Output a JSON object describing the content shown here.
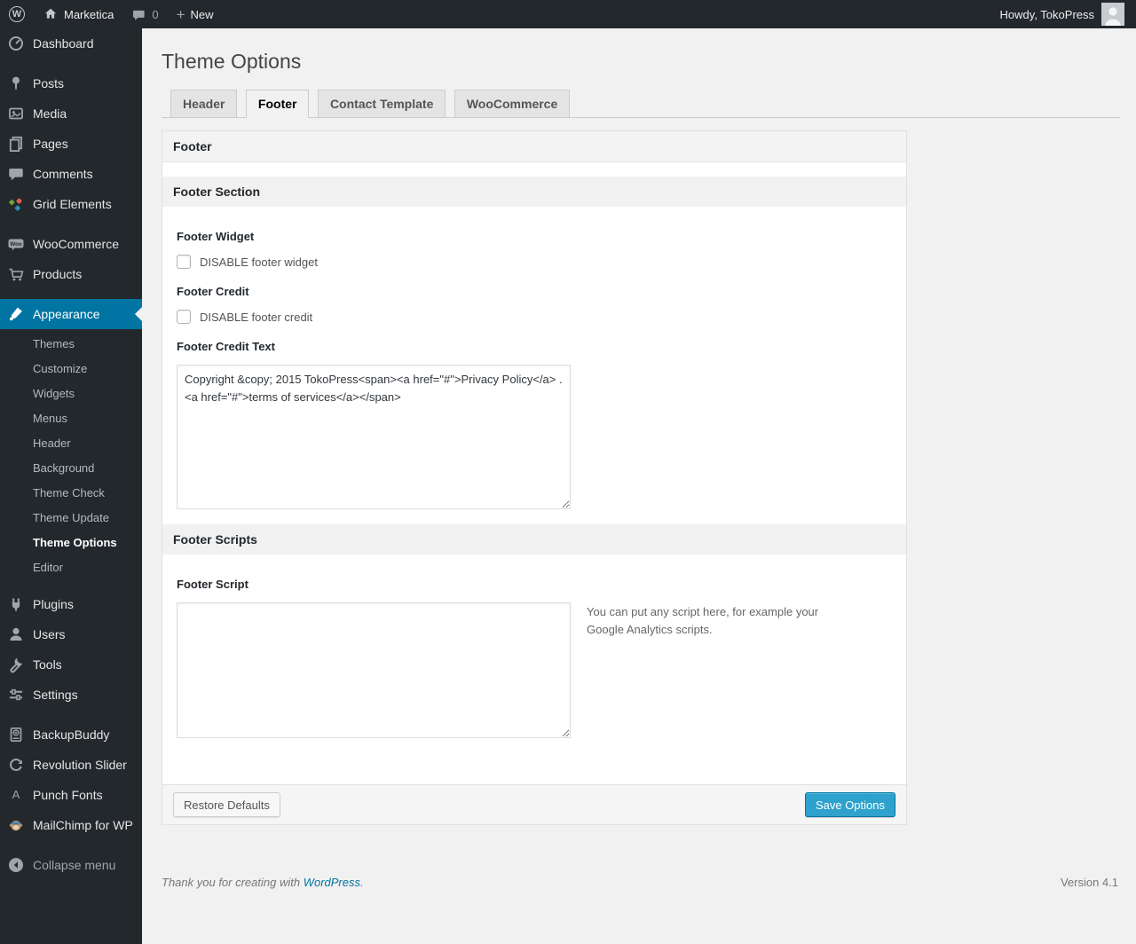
{
  "admin_bar": {
    "site_name": "Marketica",
    "comment_count": "0",
    "new_label": "New",
    "howdy": "Howdy, TokoPress"
  },
  "sidebar": {
    "menu": [
      {
        "label": "Dashboard",
        "icon": "dashboard-gauge"
      },
      {
        "label": "Posts",
        "icon": "pushpin"
      },
      {
        "label": "Media",
        "icon": "photo"
      },
      {
        "label": "Pages",
        "icon": "stacked-pages"
      },
      {
        "label": "Comments",
        "icon": "speech-bubble"
      },
      {
        "label": "Grid Elements",
        "icon": "color-pinwheel"
      },
      {
        "label": "WooCommerce",
        "icon": "woo-badge"
      },
      {
        "label": "Products",
        "icon": "cart"
      },
      {
        "label": "Appearance",
        "icon": "paintbrush"
      },
      {
        "label": "Plugins",
        "icon": "plug"
      },
      {
        "label": "Users",
        "icon": "person"
      },
      {
        "label": "Tools",
        "icon": "wrench"
      },
      {
        "label": "Settings",
        "icon": "sliders"
      },
      {
        "label": "BackupBuddy",
        "icon": "backup-drive"
      },
      {
        "label": "Revolution Slider",
        "icon": "refresh-arrows"
      },
      {
        "label": "Punch Fonts",
        "icon": "letter-a"
      },
      {
        "label": "MailChimp for WP",
        "icon": "monkey"
      }
    ],
    "appearance_submenu": [
      "Themes",
      "Customize",
      "Widgets",
      "Menus",
      "Header",
      "Background",
      "Theme Check",
      "Theme Update",
      "Theme Options",
      "Editor"
    ],
    "active_item": "Appearance",
    "active_submenu_item": "Theme Options",
    "collapse_label": "Collapse menu"
  },
  "page": {
    "title": "Theme Options",
    "tabs": [
      {
        "label": "Header",
        "active": false
      },
      {
        "label": "Footer",
        "active": true
      },
      {
        "label": "Contact Template",
        "active": false
      },
      {
        "label": "WooCommerce",
        "active": false
      }
    ]
  },
  "panel": {
    "box_title": "Footer",
    "footer_section": {
      "title": "Footer Section",
      "footer_widget_label": "Footer Widget",
      "footer_widget_checkbox": "DISABLE footer widget",
      "footer_widget_checked": false,
      "footer_credit_label": "Footer Credit",
      "footer_credit_checkbox": "DISABLE footer credit",
      "footer_credit_checked": false,
      "footer_credit_text_label": "Footer Credit Text",
      "footer_credit_text_value": "Copyright &copy; 2015 TokoPress<span><a href=\"#\">Privacy Policy</a> . <a href=\"#\">terms of services</a></span>"
    },
    "footer_scripts": {
      "title": "Footer Scripts",
      "footer_script_label": "Footer Script",
      "footer_script_value": "",
      "footer_script_help": "You can put any script here, for example your Google Analytics scripts."
    },
    "buttons": {
      "restore": "Restore Defaults",
      "save": "Save Options"
    }
  },
  "page_footer": {
    "thanks_prefix": "Thank you for creating with",
    "wordpress_link": "WordPress",
    "thanks_suffix": ".",
    "version": "Version 4.1"
  },
  "colors": {
    "accent_blue": "#0074a2",
    "primary_button": "#2ea2cc",
    "admin_bar_bg": "#23282d",
    "sidebar_bg": "#23282d",
    "page_bg": "#f1f1f1"
  }
}
